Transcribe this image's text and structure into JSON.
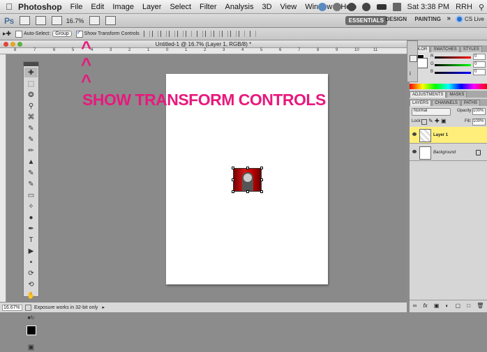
{
  "menubar": {
    "app_name": "Photoshop",
    "items": [
      "File",
      "Edit",
      "Image",
      "Layer",
      "Select",
      "Filter",
      "Analysis",
      "3D",
      "View",
      "Window",
      "Help"
    ],
    "time": "Sat 3:38 PM",
    "user": "RRH"
  },
  "appbar": {
    "logo": "Ps",
    "zoom": "16.7%",
    "workspaces": {
      "essentials": "ESSENTIALS",
      "design": "DESIGN",
      "painting": "PAINTING",
      "more": "»"
    },
    "cslive": "CS Live"
  },
  "options": {
    "auto_select_label": "Auto-Select:",
    "auto_select_value": "Group",
    "show_transform_label": "Show Transform Controls",
    "auto_select_checked": false,
    "show_transform_checked": true
  },
  "document": {
    "title": "Untitled-1 @ 16.7% (Layer 1, RGB/8) *",
    "ruler_ticks": [
      "8",
      "7",
      "6",
      "5",
      "4",
      "3",
      "2",
      "1",
      "0",
      "1",
      "2",
      "3",
      "4",
      "5",
      "6",
      "7",
      "8",
      "9",
      "10",
      "11"
    ]
  },
  "annotation": {
    "text": "SHOW TRANSFORM CONTROLS",
    "color": "#e8197d",
    "caret": "^"
  },
  "status": {
    "zoom": "16.67%",
    "message": "Exposure works in 32-bit only"
  },
  "panels": {
    "color_tabs": [
      "COLOR",
      "SWATCHES",
      "STYLES"
    ],
    "color_values": {
      "r": "0",
      "g": "0",
      "b": "0"
    },
    "adjust_tabs": [
      "ADJUSTMENTS",
      "MASKS"
    ],
    "layers_tabs": [
      "LAYERS",
      "CHANNELS",
      "PATHS"
    ],
    "blend_mode": "Normal",
    "opacity_label": "Opacity:",
    "opacity": "100%",
    "lock_label": "Lock:",
    "fill_label": "Fill:",
    "fill": "100%",
    "layers": [
      "Layer 1",
      "Background"
    ],
    "selected_layer_color": "#ffef7a"
  }
}
